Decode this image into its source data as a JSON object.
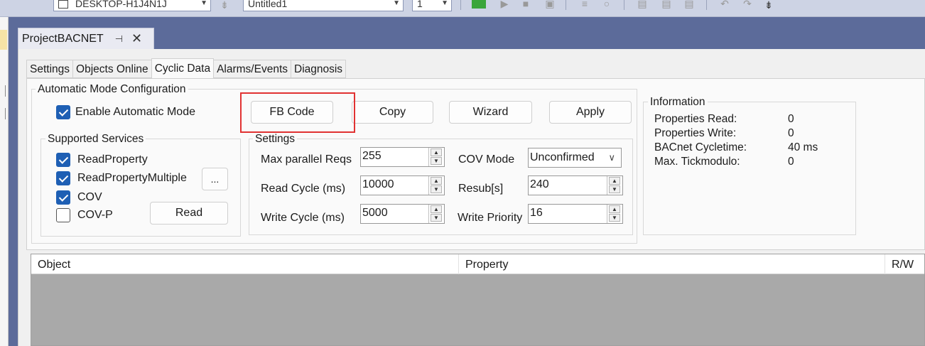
{
  "toolbar": {
    "machine": "DESKTOP-H1J4N1J",
    "config": "Untitled1",
    "instance": "1"
  },
  "doc_tab": {
    "title": "ProjectBACNET",
    "pin": "⊣",
    "close": "✕"
  },
  "tabs": [
    "Settings",
    "Objects Online",
    "Cyclic Data",
    "Alarms/Events",
    "Diagnosis"
  ],
  "active_tab": "Cyclic Data",
  "auto_mode": {
    "group_title": "Automatic Mode Configuration",
    "enable_label": "Enable Automatic Mode",
    "enable_checked": true
  },
  "buttons": {
    "fb_code": "FB Code",
    "copy": "Copy",
    "wizard": "Wizard",
    "apply": "Apply",
    "read": "Read",
    "more": "..."
  },
  "supported_services": {
    "title": "Supported Services",
    "items": [
      {
        "label": "ReadProperty",
        "checked": true
      },
      {
        "label": "ReadPropertyMultiple",
        "checked": true
      },
      {
        "label": "COV",
        "checked": true
      },
      {
        "label": "COV-P",
        "checked": false
      }
    ]
  },
  "settings": {
    "title": "Settings",
    "max_parallel_label": "Max parallel Reqs",
    "max_parallel_value": "255",
    "read_cycle_label": "Read Cycle (ms)",
    "read_cycle_value": "10000",
    "write_cycle_label": "Write Cycle (ms)",
    "write_cycle_value": "5000",
    "cov_mode_label": "COV Mode",
    "cov_mode_value": "Unconfirmed",
    "resub_label": "Resub[s]",
    "resub_value": "240",
    "write_priority_label": "Write Priority",
    "write_priority_value": "16"
  },
  "information": {
    "title": "Information",
    "rows": [
      {
        "label": "Properties Read:",
        "value": "0"
      },
      {
        "label": "Properties Write:",
        "value": "0"
      },
      {
        "label": "BACnet Cycletime:",
        "value": "40 ms"
      },
      {
        "label": "Max. Tickmodulo:",
        "value": "0"
      }
    ]
  },
  "table": {
    "columns": [
      "Object",
      "Property",
      "R/W"
    ]
  },
  "colors": {
    "accent": "#1e5fb4",
    "highlight": "#e13232",
    "frame": "#5c6b9a"
  }
}
